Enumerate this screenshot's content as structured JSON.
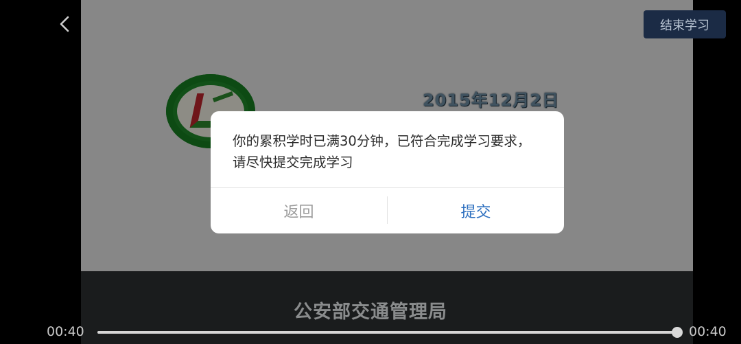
{
  "video": {
    "date_caption": "2015年12月2日",
    "organization": "公安部交通管理局"
  },
  "header": {
    "back_icon": "chevron-left-icon",
    "finish_button": "结束学习"
  },
  "player": {
    "current_time": "00:40",
    "total_time": "00:40",
    "progress": 1.0
  },
  "dialog": {
    "message": "你的累积学时已满30分钟，已符合完成学习要求，请尽快提交完成学习",
    "back_button": "返回",
    "submit_button": "提交"
  }
}
